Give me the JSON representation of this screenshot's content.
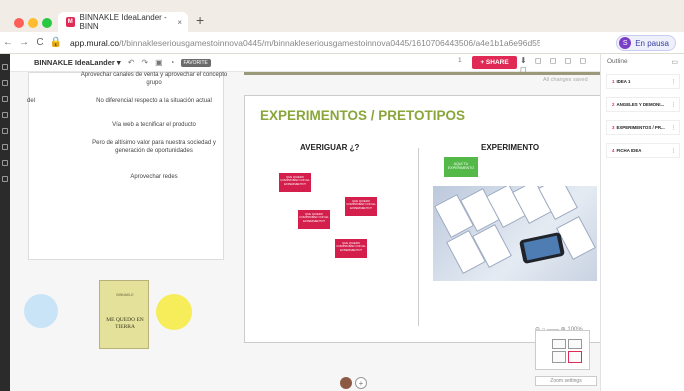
{
  "browser": {
    "tab_title": "BINNAKLE IdeaLander - BINN",
    "favicon": "M",
    "tab_close": "×",
    "new_tab": "+",
    "url_main": "app.mural.co",
    "url_rest": "/t/binnakleseriousgamestoinnova0445/m/binnakleseriousgamestoinnova0445/1610706443506/a4e1b1a6e96d551...",
    "nav": [
      "←",
      "→",
      "C"
    ],
    "profile_initial": "S",
    "profile_status": "En pausa"
  },
  "toolbar": {
    "board_name": "BINNAKLE IdeaLander ▾",
    "badge": "FAVORITE",
    "share_label": "+ SHARE",
    "people_count": "1",
    "icons": "⬇ ◻ ◻ ◻ ◻ ◻"
  },
  "canvas": {
    "saved_text": "All changes saved",
    "left_texts": [
      "Aprovechar canales de venta y aprovechar el concepto grupo",
      "No diferencial respecto a la situación actual",
      "Vía web a tecnificar el producto",
      "Pero de altísimo valor para nuestra sociedad y generación de oportunidades",
      "Aprovechar redes"
    ],
    "left_del": "del",
    "board_title": "EXPERIMENTOS / PRETOTIPOS",
    "col_left": "AVERIGUAR ¿?",
    "col_right": "EXPERIMENTO",
    "sticky_text": "QUE QUIERO COMPROBAR CON EL EXPERIMENTO?",
    "green_text": "AQUÍ TU EXPERIMENTO",
    "book_title": "ME QUEDO EN TIERRA",
    "book_brand": "BINNAKLE",
    "zoom_label": "Zoom settings",
    "zoom_value": "100%"
  },
  "outline": {
    "title": "Outline",
    "items": [
      {
        "n": "1",
        "label": "IDEA 1"
      },
      {
        "n": "2",
        "label": "ANGELES Y DEMONI..."
      },
      {
        "n": "3",
        "label": "EXPERIMENTOS / PR..."
      },
      {
        "n": "4",
        "label": "FICHA IDEA"
      }
    ]
  },
  "colors": {
    "accent": "#e02a55",
    "title_green": "#8aa63a",
    "sticky_red": "#d41e4b",
    "sticky_green": "#54b948"
  }
}
